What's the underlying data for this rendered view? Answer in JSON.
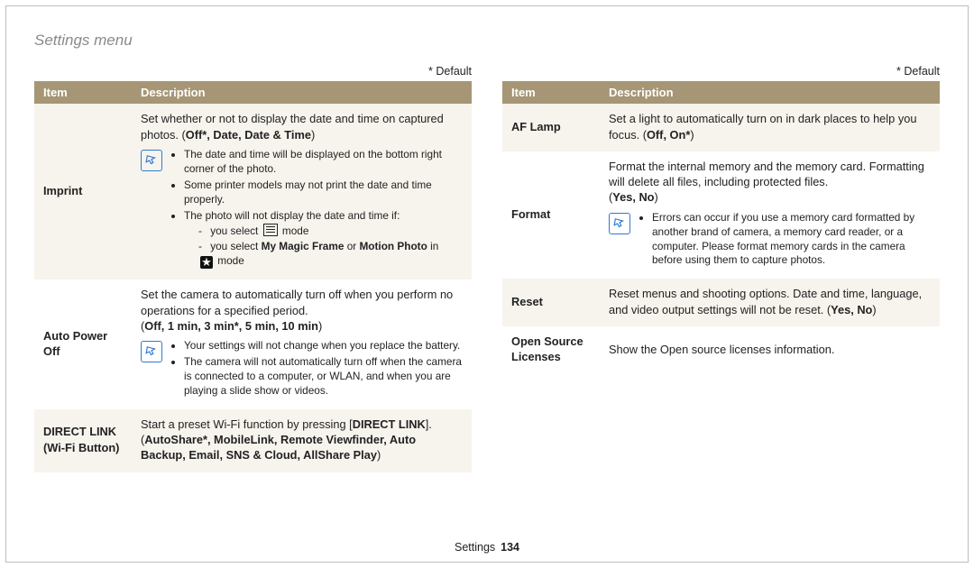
{
  "page_title": "Settings menu",
  "default_note": "* Default",
  "headers": {
    "item": "Item",
    "description": "Description"
  },
  "footer": {
    "section": "Settings",
    "page": "134"
  },
  "left": {
    "rows": [
      {
        "item": "Imprint",
        "intro": "Set whether or not to display the date and time on captured photos. (",
        "opts": "Off*, Date, Date & Time",
        "note": {
          "bullets": [
            "The date and time will be displayed on the bottom right corner of the photo.",
            "Some printer models may not print the date and time properly.",
            "The photo will not display the date and time if:"
          ],
          "sub_prefix1": "you select ",
          "sub_suffix1": " mode",
          "sub_line2_a": "you select ",
          "sub_line2_b": "My Magic Frame",
          "sub_line2_c": " or ",
          "sub_line2_d": "Motion Photo",
          "sub_line2_e": " in ",
          "sub_line2_f": " mode"
        }
      },
      {
        "item": "Auto Power Off",
        "intro": "Set the camera to automatically turn off when you perform no operations for a specified period.",
        "opts": "Off, 1 min, 3 min*, 5 min, 10 min",
        "note": {
          "bullets": [
            "Your settings will not change when you replace the battery.",
            "The camera will not automatically turn off when the camera is connected to a computer, or WLAN, and when you are playing a slide show or videos."
          ]
        }
      },
      {
        "item": "DIRECT LINK (Wi-Fi Button)",
        "intro_a": "Start a preset Wi-Fi function by pressing [",
        "intro_b": "DIRECT LINK",
        "intro_c": "].",
        "opts": "AutoShare*, MobileLink, Remote Viewfinder, Auto Backup, Email, SNS & Cloud, AllShare Play"
      }
    ]
  },
  "right": {
    "rows": [
      {
        "item": "AF Lamp",
        "intro": "Set a light to automatically turn on in dark places to help you focus. (",
        "opts": "Off, On*"
      },
      {
        "item": "Format",
        "intro": "Format the internal memory and the memory card. Formatting will delete all files, including protected files.",
        "opts": "Yes, No",
        "note": {
          "bullets": [
            "Errors can occur if you use a memory card formatted by another brand of camera, a memory card reader, or a computer. Please format memory cards in the camera before using them to capture photos."
          ]
        }
      },
      {
        "item": "Reset",
        "intro": "Reset menus and shooting options. Date and time, language, and video output settings will not be reset. (",
        "opts": "Yes, No"
      },
      {
        "item": "Open Source Licenses",
        "intro": "Show the Open source licenses information."
      }
    ]
  }
}
